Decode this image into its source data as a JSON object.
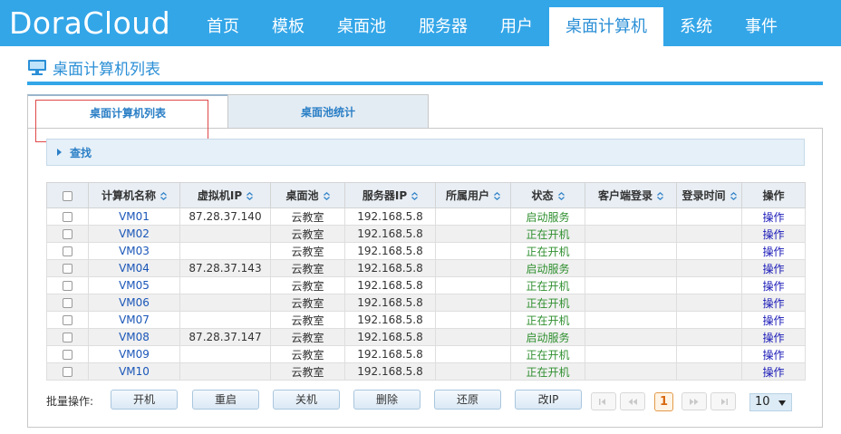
{
  "app": {
    "logo": "DoraCloud"
  },
  "nav": {
    "items": [
      {
        "label": "首页"
      },
      {
        "label": "模板"
      },
      {
        "label": "桌面池"
      },
      {
        "label": "服务器"
      },
      {
        "label": "用户"
      },
      {
        "label": "桌面计算机"
      },
      {
        "label": "系统"
      },
      {
        "label": "事件"
      }
    ],
    "active_index": 5
  },
  "page": {
    "title": "桌面计算机列表",
    "icon": "monitor-icon"
  },
  "tabs": [
    {
      "label": "桌面计算机列表"
    },
    {
      "label": "桌面池统计"
    }
  ],
  "search": {
    "label": "查找"
  },
  "table": {
    "columns": [
      {
        "label": "计算机名称"
      },
      {
        "label": "虚拟机IP"
      },
      {
        "label": "桌面池"
      },
      {
        "label": "服务器IP"
      },
      {
        "label": "所属用户"
      },
      {
        "label": "状态"
      },
      {
        "label": "客户端登录"
      },
      {
        "label": "登录时间"
      },
      {
        "label": "操作"
      }
    ],
    "rows": [
      {
        "name": "VM01",
        "vm_ip": "87.28.37.140",
        "pool": "云教室",
        "server_ip": "192.168.5.8",
        "user": "",
        "status": "启动服务",
        "client_login": "",
        "login_time": "",
        "action": "操作"
      },
      {
        "name": "VM02",
        "vm_ip": "",
        "pool": "云教室",
        "server_ip": "192.168.5.8",
        "user": "",
        "status": "正在开机",
        "client_login": "",
        "login_time": "",
        "action": "操作"
      },
      {
        "name": "VM03",
        "vm_ip": "",
        "pool": "云教室",
        "server_ip": "192.168.5.8",
        "user": "",
        "status": "正在开机",
        "client_login": "",
        "login_time": "",
        "action": "操作"
      },
      {
        "name": "VM04",
        "vm_ip": "87.28.37.143",
        "pool": "云教室",
        "server_ip": "192.168.5.8",
        "user": "",
        "status": "启动服务",
        "client_login": "",
        "login_time": "",
        "action": "操作"
      },
      {
        "name": "VM05",
        "vm_ip": "",
        "pool": "云教室",
        "server_ip": "192.168.5.8",
        "user": "",
        "status": "正在开机",
        "client_login": "",
        "login_time": "",
        "action": "操作"
      },
      {
        "name": "VM06",
        "vm_ip": "",
        "pool": "云教室",
        "server_ip": "192.168.5.8",
        "user": "",
        "status": "正在开机",
        "client_login": "",
        "login_time": "",
        "action": "操作"
      },
      {
        "name": "VM07",
        "vm_ip": "",
        "pool": "云教室",
        "server_ip": "192.168.5.8",
        "user": "",
        "status": "正在开机",
        "client_login": "",
        "login_time": "",
        "action": "操作"
      },
      {
        "name": "VM08",
        "vm_ip": "87.28.37.147",
        "pool": "云教室",
        "server_ip": "192.168.5.8",
        "user": "",
        "status": "启动服务",
        "client_login": "",
        "login_time": "",
        "action": "操作"
      },
      {
        "name": "VM09",
        "vm_ip": "",
        "pool": "云教室",
        "server_ip": "192.168.5.8",
        "user": "",
        "status": "正在开机",
        "client_login": "",
        "login_time": "",
        "action": "操作"
      },
      {
        "name": "VM10",
        "vm_ip": "",
        "pool": "云教室",
        "server_ip": "192.168.5.8",
        "user": "",
        "status": "正在开机",
        "client_login": "",
        "login_time": "",
        "action": "操作"
      }
    ]
  },
  "batch": {
    "label": "批量操作:",
    "buttons": [
      {
        "label": "开机"
      },
      {
        "label": "重启"
      },
      {
        "label": "关机"
      },
      {
        "label": "删除"
      },
      {
        "label": "还原"
      },
      {
        "label": "改IP"
      }
    ]
  },
  "pager": {
    "current_page": "1",
    "page_size": "10"
  },
  "colors": {
    "header_bg": "#33a6e8",
    "accent": "#2b8fd6",
    "status_green": "#2f8f2f",
    "link_blue": "#1a56b8",
    "focus_red": "#e04848"
  }
}
